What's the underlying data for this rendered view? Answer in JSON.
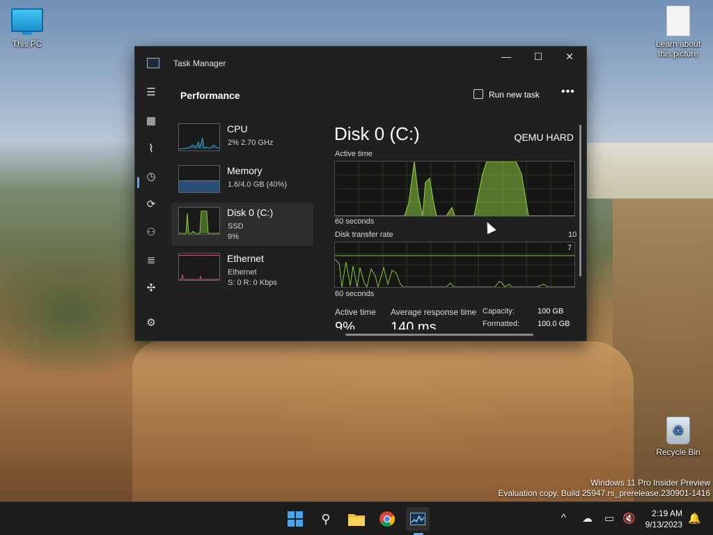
{
  "desktop": {
    "icons": [
      {
        "label": "This PC"
      },
      {
        "label": "Learn about\nthis picture"
      },
      {
        "label": "Recycle Bin"
      }
    ],
    "watermark": {
      "line1": "Windows 11 Pro Insider Preview",
      "line2": "Evaluation copy. Build 25947.rs_prerelease.230901-1416"
    }
  },
  "task_manager": {
    "title": "Task Manager",
    "page_heading": "Performance",
    "run_new_task_label": "Run new task",
    "more_label": "•••",
    "window_controls": {
      "minimize": "—",
      "maximize": "☐",
      "close": "✕"
    },
    "sidebar_items": [
      {
        "name": "CPU",
        "line1": "2%  2.70 GHz",
        "line2": "",
        "color": "#3aa0d6"
      },
      {
        "name": "Memory",
        "line1": "1.6/4.0 GB (40%)",
        "line2": "",
        "color": "#3a6fb0"
      },
      {
        "name": "Disk 0 (C:)",
        "line1": "SSD",
        "line2": "9%",
        "color": "#8ac43f"
      },
      {
        "name": "Ethernet",
        "line1": "Ethernet",
        "line2": "S: 0  R: 0 Kbps",
        "color": "#c9588a"
      }
    ],
    "detail": {
      "title": "Disk 0 (C:)",
      "model": "QEMU HARD",
      "active_time_label": "Active time",
      "active_time_axis": "60 seconds",
      "transfer_label": "Disk transfer rate",
      "transfer_axis": "60 seconds",
      "transfer_max": "10",
      "transfer_marker": "7",
      "stats": {
        "active_time_label": "Active time",
        "active_time_value": "9%",
        "avg_response_label": "Average response time",
        "avg_response_value": "140 ms",
        "capacity_label": "Capacity:",
        "capacity_value": "100 GB",
        "formatted_label": "Formatted:",
        "formatted_value": "100.0 GB"
      },
      "accent_color": "#8ac43f"
    }
  },
  "taskbar": {
    "apps": [
      "start-icon",
      "search-icon",
      "file-explorer-icon",
      "chrome-icon",
      "task-manager-icon"
    ],
    "tray": {
      "chevron": "^",
      "time": "2:19 AM",
      "date": "9/13/2023"
    }
  }
}
